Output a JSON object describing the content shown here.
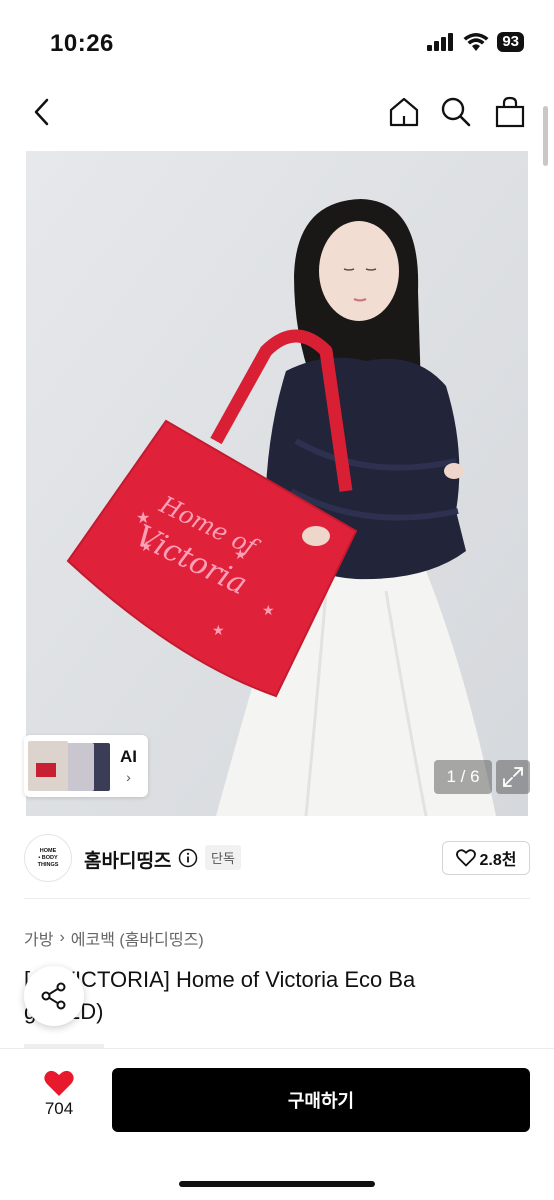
{
  "status_bar": {
    "time": "10:26",
    "battery": "93",
    "icons": [
      "signal-icon",
      "wifi-icon",
      "battery-icon"
    ]
  },
  "nav": {
    "icons": [
      "back-icon",
      "home-icon",
      "search-icon",
      "shopping-bag-icon"
    ]
  },
  "hero": {
    "bag_text": [
      "Home of",
      "Victoria"
    ],
    "bag_color": "#e0213a",
    "print_color": "#ff9fb8",
    "thumbnail_ai_label": "AI",
    "page_indicator": "1 / 6",
    "expand_icon": "expand-icon"
  },
  "brand": {
    "logo_text": [
      "HOME",
      "• BODY",
      "THINGS"
    ],
    "name": "홈바디띵즈",
    "badge": "단독",
    "like_count": "2.8천"
  },
  "breadcrumb": {
    "items": [
      "가방",
      "에코백 (홈바디띵즈)"
    ]
  },
  "product": {
    "title": "[HBT x VICTORIA] Home of Victoria Eco Bag (RED)",
    "title_visible_line1": "[  TxVICTORIA] Home of Victoria Eco Ba",
    "title_visible_line2": "g (RED)"
  },
  "bottom_bar": {
    "wish_count": "704",
    "buy_label": "구매하기",
    "accent": "#e8192c"
  }
}
